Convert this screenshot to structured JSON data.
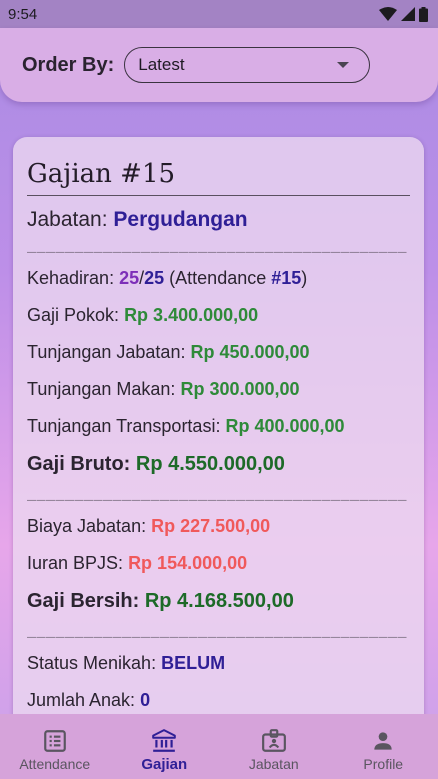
{
  "status_bar": {
    "time": "9:54"
  },
  "header": {
    "order_label": "Order By:",
    "order_value": "Latest"
  },
  "card": {
    "title": "Gajian #15",
    "jabatan_label": "Jabatan:",
    "jabatan_value": "Pergudangan",
    "dash_line": "________________________________________",
    "kehadiran": {
      "label": "Kehadiran:",
      "present": "25",
      "slash": "/",
      "total": "25",
      "paren_open": " (Attendance ",
      "attendance_id": "#15",
      "paren_close": ")"
    },
    "gaji_pokok": {
      "label": "Gaji Pokok:",
      "value": "Rp 3.400.000,00"
    },
    "tunj_jabatan": {
      "label": "Tunjangan Jabatan:",
      "value": "Rp 450.000,00"
    },
    "tunj_makan": {
      "label": "Tunjangan Makan:",
      "value": "Rp 300.000,00"
    },
    "tunj_transport": {
      "label": "Tunjangan Transportasi:",
      "value": "Rp 400.000,00"
    },
    "gaji_bruto": {
      "label": "Gaji Bruto:",
      "value": "Rp 4.550.000,00"
    },
    "biaya_jabatan": {
      "label": "Biaya Jabatan:",
      "value": "Rp 227.500,00"
    },
    "iuran_bpjs": {
      "label": "Iuran BPJS:",
      "value": "Rp 154.000,00"
    },
    "gaji_bersih": {
      "label": "Gaji Bersih:",
      "value": "Rp 4.168.500,00"
    },
    "status_menikah": {
      "label": "Status Menikah:",
      "value": "BELUM"
    },
    "jumlah_anak": {
      "label": "Jumlah Anak:",
      "value": "0"
    }
  },
  "bottom_nav": [
    {
      "label": "Attendance",
      "icon": "list-icon",
      "active": false
    },
    {
      "label": "Gajian",
      "icon": "bank-icon",
      "active": true
    },
    {
      "label": "Jabatan",
      "icon": "badge-icon",
      "active": false
    },
    {
      "label": "Profile",
      "icon": "person-icon",
      "active": false
    }
  ],
  "colors": {
    "accent": "#2f1f96",
    "positive": "#2e8a39",
    "negative": "#f0595b"
  }
}
